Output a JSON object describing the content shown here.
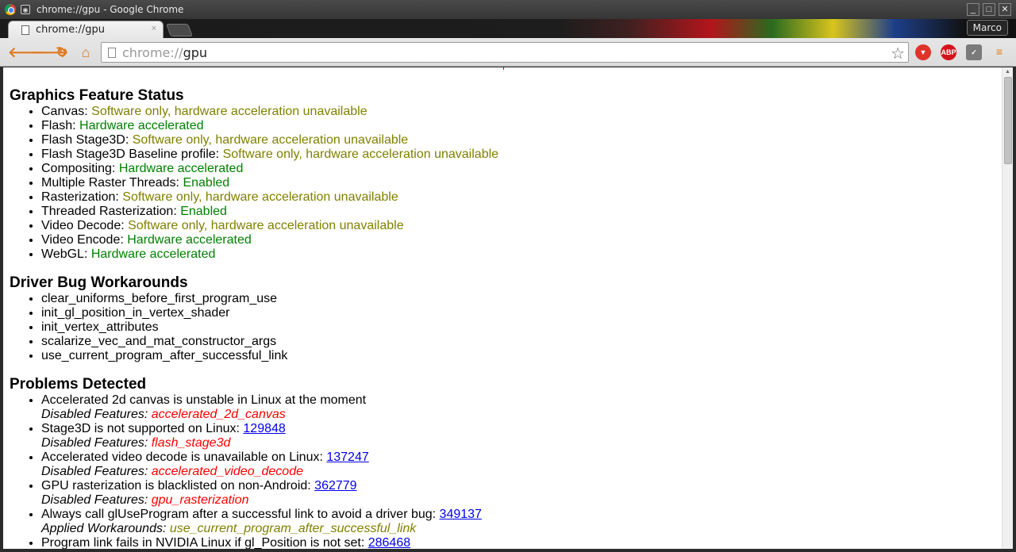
{
  "window": {
    "title": "chrome://gpu - Google Chrome",
    "profile": "Marco",
    "controls": {
      "minimize": "_",
      "maximize": "□",
      "close": "✕"
    }
  },
  "tabs": [
    {
      "title": "chrome://gpu",
      "close": "×"
    }
  ],
  "omnibox": {
    "scheme": "chrome://",
    "host": "gpu"
  },
  "extensions": {
    "abp": "ABP"
  },
  "feature_status": {
    "heading": "Graphics Feature Status",
    "items": [
      {
        "label": "Canvas:",
        "value": "Software only, hardware acceleration unavailable",
        "status": "y"
      },
      {
        "label": "Flash:",
        "value": "Hardware accelerated",
        "status": "g"
      },
      {
        "label": "Flash Stage3D:",
        "value": "Software only, hardware acceleration unavailable",
        "status": "y"
      },
      {
        "label": "Flash Stage3D Baseline profile:",
        "value": "Software only, hardware acceleration unavailable",
        "status": "y"
      },
      {
        "label": "Compositing:",
        "value": "Hardware accelerated",
        "status": "g"
      },
      {
        "label": "Multiple Raster Threads:",
        "value": "Enabled",
        "status": "g"
      },
      {
        "label": "Rasterization:",
        "value": "Software only, hardware acceleration unavailable",
        "status": "y"
      },
      {
        "label": "Threaded Rasterization:",
        "value": "Enabled",
        "status": "g"
      },
      {
        "label": "Video Decode:",
        "value": "Software only, hardware acceleration unavailable",
        "status": "y"
      },
      {
        "label": "Video Encode:",
        "value": "Hardware accelerated",
        "status": "g"
      },
      {
        "label": "WebGL:",
        "value": "Hardware accelerated",
        "status": "g"
      }
    ]
  },
  "workarounds": {
    "heading": "Driver Bug Workarounds",
    "items": [
      "clear_uniforms_before_first_program_use",
      "init_gl_position_in_vertex_shader",
      "init_vertex_attributes",
      "scalarize_vec_and_mat_constructor_args",
      "use_current_program_after_successful_link"
    ]
  },
  "problems": {
    "heading": "Problems Detected",
    "items": [
      {
        "text": "Accelerated 2d canvas is unstable in Linux at the moment",
        "link": "",
        "sub_label": "Disabled Features:",
        "sub_value": "accelerated_2d_canvas",
        "sub_color": "r"
      },
      {
        "text": "Stage3D is not supported on Linux: ",
        "link": "129848",
        "sub_label": "Disabled Features:",
        "sub_value": "flash_stage3d",
        "sub_color": "r"
      },
      {
        "text": "Accelerated video decode is unavailable on Linux: ",
        "link": "137247",
        "sub_label": "Disabled Features:",
        "sub_value": "accelerated_video_decode",
        "sub_color": "r"
      },
      {
        "text": "GPU rasterization is blacklisted on non-Android: ",
        "link": "362779",
        "sub_label": "Disabled Features:",
        "sub_value": "gpu_rasterization",
        "sub_color": "r"
      },
      {
        "text": "Always call glUseProgram after a successful link to avoid a driver bug: ",
        "link": "349137",
        "sub_label": "Applied Workarounds:",
        "sub_value": "use_current_program_after_successful_link",
        "sub_color": "y"
      },
      {
        "text": "Program link fails in NVIDIA Linux if gl_Position is not set: ",
        "link": "286468",
        "sub_label": "",
        "sub_value": "",
        "sub_color": "y"
      }
    ]
  }
}
